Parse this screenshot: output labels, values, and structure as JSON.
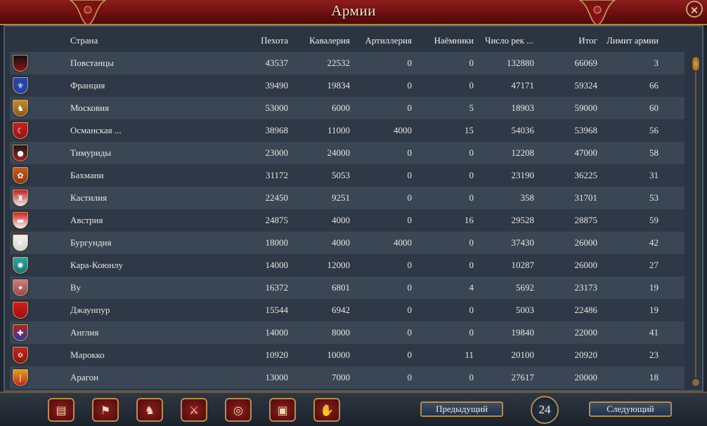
{
  "window": {
    "title": "Армии",
    "close_icon": "close-icon"
  },
  "columns": {
    "country": "Страна",
    "infantry": "Пехота",
    "cavalry": "Кавалерия",
    "artillery": "Артиллерия",
    "mercenaries": "Наёмники",
    "regiments": "Число рек ...",
    "total": "Итог",
    "force_limit": "Лимит армии"
  },
  "rows": [
    {
      "country": "Повстанцы",
      "infantry": "43537",
      "cavalry": "22532",
      "artillery": "0",
      "mercenaries": "0",
      "regiments": "132880",
      "total": "66069",
      "force_limit": "3",
      "shield": {
        "c1": "#111111",
        "c2": "#8e1414",
        "sym": ""
      }
    },
    {
      "country": "Франция",
      "infantry": "39490",
      "cavalry": "19834",
      "artillery": "0",
      "mercenaries": "0",
      "regiments": "47171",
      "total": "59324",
      "force_limit": "66",
      "shield": {
        "c1": "#2643a8",
        "c2": "#2643a8",
        "sym": "⚜"
      }
    },
    {
      "country": "Московия",
      "infantry": "53000",
      "cavalry": "6000",
      "artillery": "0",
      "mercenaries": "5",
      "regiments": "18903",
      "total": "59000",
      "force_limit": "60",
      "shield": {
        "c1": "#c28b2e",
        "c2": "#8d5b17",
        "sym": "♞"
      }
    },
    {
      "country": "Османская ...",
      "infantry": "38968",
      "cavalry": "11000",
      "artillery": "4000",
      "mercenaries": "15",
      "regiments": "54036",
      "total": "53968",
      "force_limit": "56",
      "shield": {
        "c1": "#c42121",
        "c2": "#9a1414",
        "sym": "☾"
      }
    },
    {
      "country": "Тимуриды",
      "infantry": "23000",
      "cavalry": "24000",
      "artillery": "0",
      "mercenaries": "0",
      "regiments": "12208",
      "total": "47000",
      "force_limit": "58",
      "shield": {
        "c1": "#1a1a1a",
        "c2": "#a91d1d",
        "sym": "●"
      }
    },
    {
      "country": "Бахмани",
      "infantry": "31172",
      "cavalry": "5053",
      "artillery": "0",
      "mercenaries": "0",
      "regiments": "23190",
      "total": "36225",
      "force_limit": "31",
      "shield": {
        "c1": "#c75a1a",
        "c2": "#8a3a10",
        "sym": "✿"
      }
    },
    {
      "country": "Кастилия",
      "infantry": "22450",
      "cavalry": "9251",
      "artillery": "0",
      "mercenaries": "0",
      "regiments": "358",
      "total": "31701",
      "force_limit": "53",
      "shield": {
        "c1": "#c22020",
        "c2": "#e6e6e6",
        "sym": "♜"
      }
    },
    {
      "country": "Австрия",
      "infantry": "24875",
      "cavalry": "4000",
      "artillery": "0",
      "mercenaries": "16",
      "regiments": "29528",
      "total": "28875",
      "force_limit": "59",
      "shield": {
        "c1": "#d11f1f",
        "c2": "#f2f2f2",
        "sym": "▬"
      }
    },
    {
      "country": "Бургундия",
      "infantry": "18000",
      "cavalry": "4000",
      "artillery": "4000",
      "mercenaries": "0",
      "regiments": "37430",
      "total": "26000",
      "force_limit": "42",
      "shield": {
        "c1": "#f0f0f0",
        "c2": "#d6d6d6",
        "sym": "✕"
      }
    },
    {
      "country": "Кара-Коюнлу",
      "infantry": "14000",
      "cavalry": "12000",
      "artillery": "0",
      "mercenaries": "0",
      "regiments": "10287",
      "total": "26000",
      "force_limit": "27",
      "shield": {
        "c1": "#2fa6a0",
        "c2": "#1c7772",
        "sym": "✺"
      }
    },
    {
      "country": "Ву",
      "infantry": "16372",
      "cavalry": "6801",
      "artillery": "0",
      "mercenaries": "4",
      "regiments": "5692",
      "total": "23173",
      "force_limit": "19",
      "shield": {
        "c1": "#c97a7a",
        "c2": "#9a4c4c",
        "sym": "✦"
      }
    },
    {
      "country": "Джаунпур",
      "infantry": "15544",
      "cavalry": "6942",
      "artillery": "0",
      "mercenaries": "0",
      "regiments": "5003",
      "total": "22486",
      "force_limit": "19",
      "shield": {
        "c1": "#d41b1b",
        "c2": "#a30f0f",
        "sym": ""
      }
    },
    {
      "country": "Англия",
      "infantry": "14000",
      "cavalry": "8000",
      "artillery": "0",
      "mercenaries": "0",
      "regiments": "19840",
      "total": "22000",
      "force_limit": "41",
      "shield": {
        "c1": "#b5202a",
        "c2": "#2a3c9a",
        "sym": "✚"
      }
    },
    {
      "country": "Марокко",
      "infantry": "10920",
      "cavalry": "10000",
      "artillery": "0",
      "mercenaries": "11",
      "regiments": "20100",
      "total": "20920",
      "force_limit": "23",
      "shield": {
        "c1": "#c2281d",
        "c2": "#8d170f",
        "sym": "✡"
      }
    },
    {
      "country": "Арагон",
      "infantry": "13000",
      "cavalry": "7000",
      "artillery": "0",
      "mercenaries": "0",
      "regiments": "27617",
      "total": "20000",
      "force_limit": "18",
      "shield": {
        "c1": "#e0a21a",
        "c2": "#c2251d",
        "sym": "❘"
      }
    }
  ],
  "footer": {
    "buttons": [
      {
        "name": "ledger-icon",
        "glyph": "▤"
      },
      {
        "name": "flag-icon",
        "glyph": "⚑"
      },
      {
        "name": "army-icon",
        "glyph": "♞"
      },
      {
        "name": "crossed-swords-icon",
        "glyph": "⚔"
      },
      {
        "name": "coins-icon",
        "glyph": "◎"
      },
      {
        "name": "buildings-icon",
        "glyph": "▣"
      },
      {
        "name": "handshake-icon",
        "glyph": "✋"
      }
    ],
    "prev_label": "Предыдущий",
    "page": "24",
    "next_label": "Следующий"
  }
}
